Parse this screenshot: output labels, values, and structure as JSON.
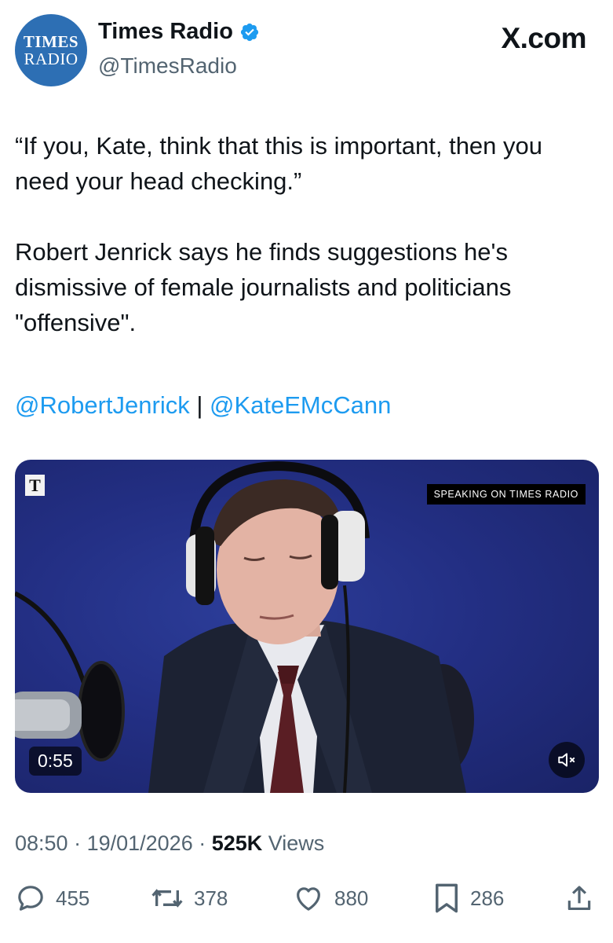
{
  "account": {
    "avatar_line1": "TIMES",
    "avatar_line2": "RADIO",
    "display_name": "Times Radio",
    "handle": "@TimesRadio",
    "verified_color": "#1d9bf0"
  },
  "site_mark": "X.com",
  "tweet": {
    "quote": "“If you, Kate, think that this is important, then you need your head checking.”",
    "body": "Robert Jenrick says he finds suggestions he's dismissive of female journalists and politicians \"offensive\".",
    "mention1": "@RobertJenrick",
    "separator": " | ",
    "mention2": "@KateEMcCann"
  },
  "video": {
    "logo_letter": "T",
    "overlay_tag": "SPEAKING ON TIMES RADIO",
    "duration": "0:55",
    "mute_icon": "speaker-muted-icon"
  },
  "meta": {
    "time": "08:50",
    "dot1": " · ",
    "date": "19/01/2026",
    "dot2": " · ",
    "views_count": "525K",
    "views_label": " Views"
  },
  "actions": {
    "replies": "455",
    "reposts": "378",
    "likes": "880",
    "bookmarks": "286"
  },
  "colors": {
    "link": "#1d9bf0",
    "muted_text": "#536471",
    "avatar_bg": "#2d6fb4",
    "video_bg": "#232f84"
  }
}
